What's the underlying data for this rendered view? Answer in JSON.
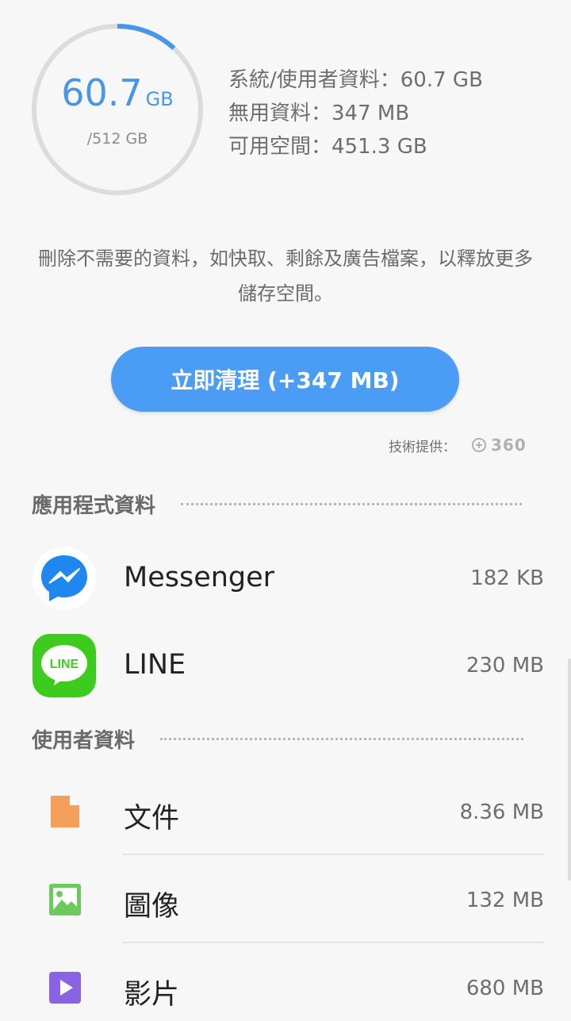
{
  "storage": {
    "used_value": "60.7",
    "used_unit": "GB",
    "total": "/512 GB",
    "used_fraction": 0.1186,
    "accent": "#4a96e6"
  },
  "stats": {
    "system": "系統/使用者資料：60.7 GB",
    "junk": "無用資料：347 MB",
    "free": "可用空間：451.3 GB"
  },
  "description": "刪除不需要的資料，如快取、剩餘及廣告檔案，以釋放更多儲存空間。",
  "clean_button": {
    "label": "立即清理 (+347 MB)",
    "color": "#4b9cf5"
  },
  "provider": {
    "label": "技術提供：",
    "logo": "360"
  },
  "app_section": {
    "title": "應用程式資料",
    "items": [
      {
        "name": "Messenger",
        "size": "182 KB",
        "icon": "messenger-icon"
      },
      {
        "name": "LINE",
        "size": "230 MB",
        "icon": "line-icon",
        "icon_text": "LINE"
      }
    ]
  },
  "user_section": {
    "title": "使用者資料",
    "items": [
      {
        "name": "文件",
        "size": "8.36 MB",
        "icon": "document-icon"
      },
      {
        "name": "圖像",
        "size": "132 MB",
        "icon": "image-icon"
      },
      {
        "name": "影片",
        "size": "680 MB",
        "icon": "video-icon"
      }
    ]
  }
}
